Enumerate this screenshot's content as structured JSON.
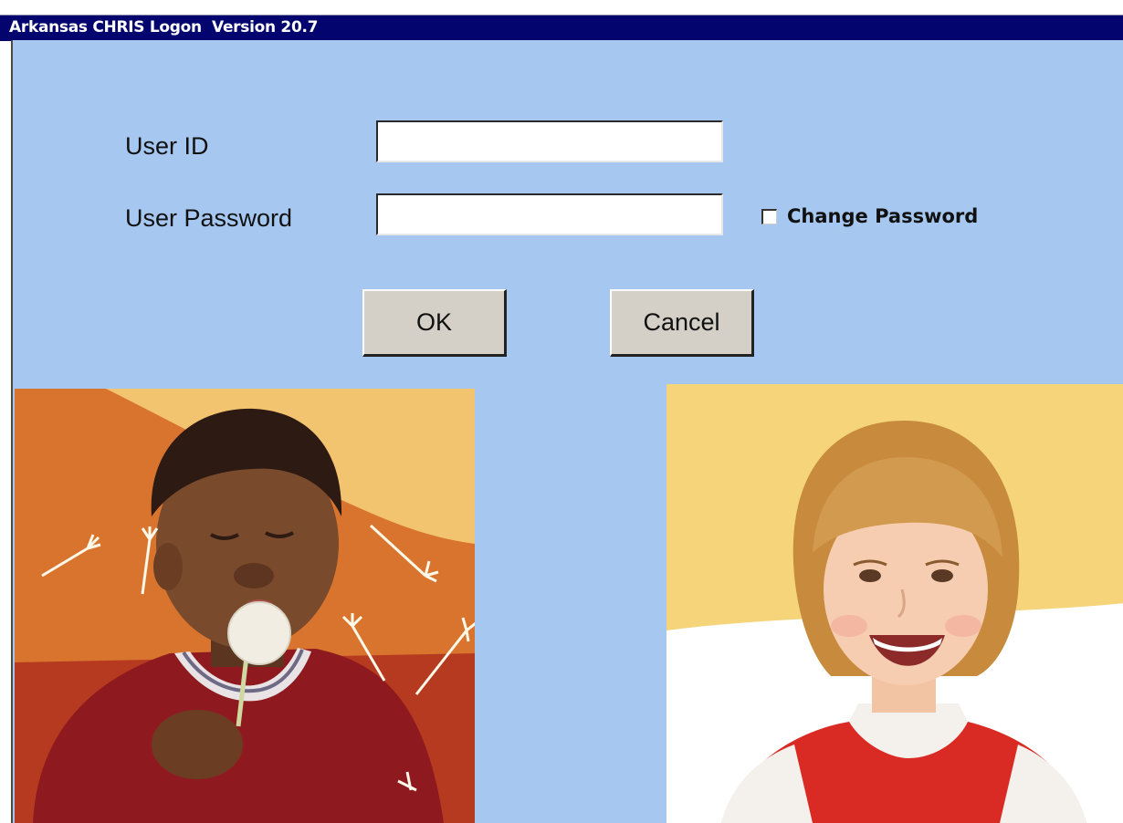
{
  "window": {
    "title": "Arkansas CHRIS Logon  Version 20.7"
  },
  "form": {
    "user_id_label": "User ID",
    "user_id_value": "",
    "password_label": "User Password",
    "password_value": "",
    "change_password_label": "Change Password",
    "change_password_checked": false
  },
  "buttons": {
    "ok_label": "OK",
    "cancel_label": "Cancel"
  },
  "colors": {
    "titlebar": "#04046e",
    "background": "#a6c8f0",
    "button_face": "#d4d0c8"
  }
}
